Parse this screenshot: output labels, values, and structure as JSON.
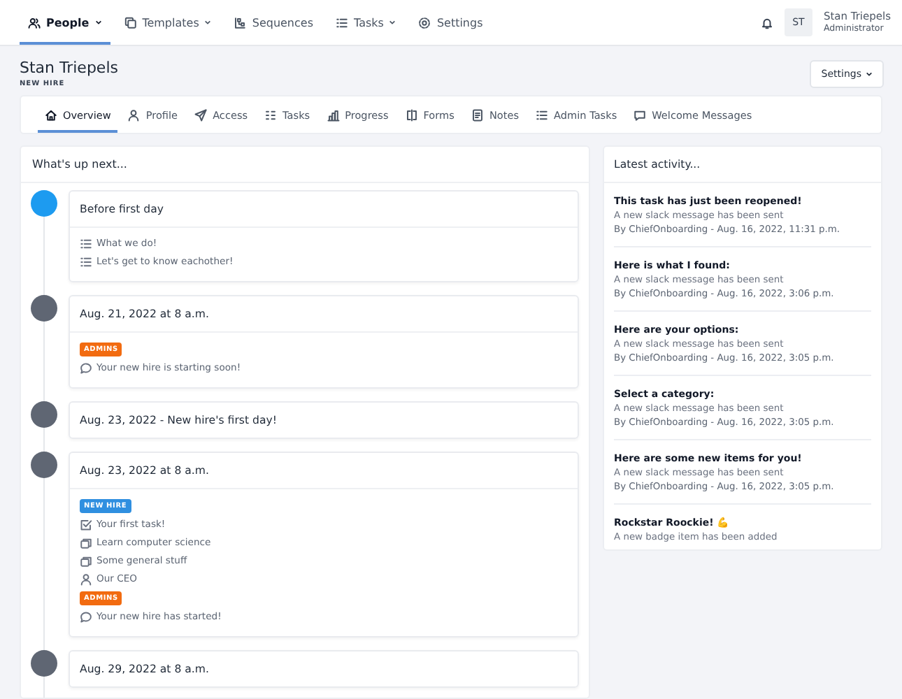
{
  "nav": {
    "items": [
      {
        "label": "People",
        "selected": true,
        "dropdown": true
      },
      {
        "label": "Templates",
        "selected": false,
        "dropdown": true
      },
      {
        "label": "Sequences",
        "selected": false,
        "dropdown": false
      },
      {
        "label": "Tasks",
        "selected": false,
        "dropdown": true
      },
      {
        "label": "Settings",
        "selected": false,
        "dropdown": false
      }
    ],
    "user": {
      "initials": "ST",
      "name": "Stan Triepels",
      "role": "Administrator"
    }
  },
  "header": {
    "name": "Stan Triepels",
    "subtitle": "NEW HIRE",
    "settings_button": "Settings"
  },
  "tabs": [
    {
      "label": "Overview",
      "selected": true
    },
    {
      "label": "Profile",
      "selected": false
    },
    {
      "label": "Access",
      "selected": false
    },
    {
      "label": "Tasks",
      "selected": false
    },
    {
      "label": "Progress",
      "selected": false
    },
    {
      "label": "Forms",
      "selected": false
    },
    {
      "label": "Notes",
      "selected": false
    },
    {
      "label": "Admin Tasks",
      "selected": false
    },
    {
      "label": "Welcome Messages",
      "selected": false
    }
  ],
  "timeline": {
    "title": "What's up next...",
    "items": [
      {
        "title": "Before first day",
        "color": "#1d9bf0",
        "entries": [
          {
            "kind": "preboarding",
            "text": "What we do!"
          },
          {
            "kind": "preboarding",
            "text": "Let's get to know eachother!"
          }
        ]
      },
      {
        "title": "Aug. 21, 2022 at 8 a.m.",
        "color": "#5f6673",
        "entries": [
          {
            "kind": "tag",
            "text": "ADMINS",
            "color": "#f26b10"
          },
          {
            "kind": "message",
            "text": "Your new hire is starting soon!"
          }
        ]
      },
      {
        "title": "Aug. 23, 2022 - New hire's first day!",
        "color": "#5f6673"
      },
      {
        "title": "Aug. 23, 2022 at 8 a.m.",
        "color": "#5f6673",
        "entries": [
          {
            "kind": "tag",
            "text": "NEW HIRE",
            "color": "#2f8fe0"
          },
          {
            "kind": "todo",
            "text": "Your first task!"
          },
          {
            "kind": "resource",
            "text": "Learn computer science"
          },
          {
            "kind": "resource",
            "text": "Some general stuff"
          },
          {
            "kind": "introduction",
            "text": "Our CEO"
          },
          {
            "kind": "tag",
            "text": "ADMINS",
            "color": "#f26b10"
          },
          {
            "kind": "message",
            "text": "Your new hire has started!"
          }
        ]
      },
      {
        "title": "Aug. 29, 2022 at 8 a.m.",
        "color": "#5f6673"
      }
    ]
  },
  "activity": {
    "title": "Latest activity...",
    "items": [
      {
        "title": "This task has just been reopened!",
        "description": "A new slack message has been sent",
        "meta": "By ChiefOnboarding - Aug. 16, 2022, 11:31 p.m."
      },
      {
        "title": "Here is what I found:",
        "description": "A new slack message has been sent",
        "meta": "By ChiefOnboarding - Aug. 16, 2022, 3:06 p.m."
      },
      {
        "title": "Here are your options:",
        "description": "A new slack message has been sent",
        "meta": "By ChiefOnboarding - Aug. 16, 2022, 3:05 p.m."
      },
      {
        "title": "Select a category:",
        "description": "A new slack message has been sent",
        "meta": "By ChiefOnboarding - Aug. 16, 2022, 3:05 p.m."
      },
      {
        "title": "Here are some new items for you!",
        "description": "A new slack message has been sent",
        "meta": "By ChiefOnboarding - Aug. 16, 2022, 3:05 p.m."
      },
      {
        "title": "Rockstar Roockie! 💪",
        "description": "A new badge item has been added"
      }
    ]
  }
}
